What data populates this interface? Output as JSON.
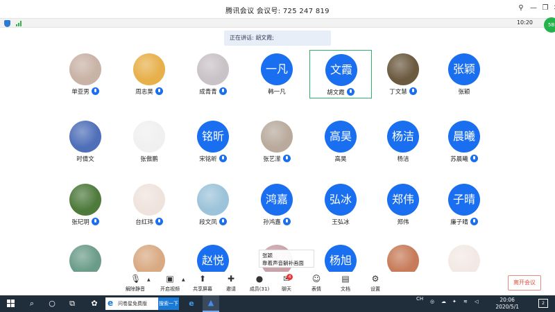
{
  "window": {
    "title": "腾讯会议  会议号: 725 247 819",
    "controls": [
      "⚲",
      "—",
      "❐",
      "✕"
    ]
  },
  "statusbar": {
    "time": "10:20",
    "bubble": "5B"
  },
  "speaking": "正在讲话: 胡文霞;",
  "participants": [
    {
      "name": "单亚男",
      "type": "photo",
      "color": "#c9b2a6",
      "mic": true
    },
    {
      "name": "周志昊",
      "type": "photo",
      "color": "#e7b04a",
      "mic": true
    },
    {
      "name": "成青青",
      "type": "photo",
      "color": "#c9c2c6",
      "mic": true
    },
    {
      "name": "韩一凡",
      "type": "text",
      "initials": "一凡",
      "mic": false
    },
    {
      "name": "胡文霞",
      "type": "text",
      "initials": "文霞",
      "mic": true,
      "active": true
    },
    {
      "name": "丁文慧",
      "type": "photo",
      "color": "#6c5a40",
      "mic": true
    },
    {
      "name": "张颖",
      "type": "text",
      "initials": "张颖",
      "mic": false
    },
    {
      "name": "时倩文",
      "type": "photo",
      "color": "#4f6fb8",
      "mic": false
    },
    {
      "name": "张傲鹏",
      "type": "photo",
      "color": "#f0f0f0",
      "mic": false
    },
    {
      "name": "宋铭昕",
      "type": "text",
      "initials": "铭昕",
      "mic": true
    },
    {
      "name": "张艺潆",
      "type": "photo",
      "color": "#b9aa9c",
      "mic": true
    },
    {
      "name": "高昊",
      "type": "text",
      "initials": "高昊",
      "mic": false
    },
    {
      "name": "杨洁",
      "type": "text",
      "initials": "杨洁",
      "mic": false
    },
    {
      "name": "苏晨曦",
      "type": "text",
      "initials": "晨曦",
      "mic": true
    },
    {
      "name": "张玘玥",
      "type": "photo",
      "color": "#4e7a3c",
      "mic": true
    },
    {
      "name": "台红玮",
      "type": "photo",
      "color": "#efe3dd",
      "mic": true
    },
    {
      "name": "段文凤",
      "type": "photo",
      "color": "#9cc3d9",
      "mic": true
    },
    {
      "name": "孙鸿嘉",
      "type": "text",
      "initials": "鸿嘉",
      "mic": true
    },
    {
      "name": "王弘冰",
      "type": "text",
      "initials": "弘冰",
      "mic": false
    },
    {
      "name": "郑伟",
      "type": "text",
      "initials": "郑伟",
      "mic": false
    },
    {
      "name": "廉子晴",
      "type": "text",
      "initials": "子晴",
      "mic": true
    },
    {
      "name": "",
      "type": "photo",
      "color": "#6b9c8a",
      "mic": false
    },
    {
      "name": "",
      "type": "photo",
      "color": "#d9a982",
      "mic": false
    },
    {
      "name": "",
      "type": "text",
      "initials": "赵悦",
      "mic": false
    },
    {
      "name": "",
      "type": "photo",
      "color": "#c8a0a8",
      "mic": false
    },
    {
      "name": "",
      "type": "text",
      "initials": "杨旭",
      "mic": false
    },
    {
      "name": "",
      "type": "photo",
      "color": "#c77b59",
      "mic": false
    },
    {
      "name": "",
      "type": "photo",
      "color": "#f3e9e4",
      "mic": false
    }
  ],
  "tooltip": {
    "name": "张颖",
    "text": "靠着声音躺补画面"
  },
  "toolbar": {
    "buttons": [
      {
        "label": "解除静音",
        "icon": "mic-off-icon",
        "glyph": "🎙"
      },
      {
        "label": "开启视频",
        "icon": "camera-off-icon",
        "glyph": "▣"
      },
      {
        "label": "共享屏幕",
        "icon": "share-screen-icon",
        "glyph": "⬆"
      },
      {
        "label": "邀请",
        "icon": "invite-icon",
        "glyph": "✚"
      },
      {
        "label": "成员(31)",
        "icon": "members-icon",
        "glyph": "●"
      },
      {
        "label": "聊天",
        "icon": "chat-icon",
        "glyph": "✉"
      },
      {
        "label": "表情",
        "icon": "emoji-icon",
        "glyph": "☺"
      },
      {
        "label": "文档",
        "icon": "document-icon",
        "glyph": "▤"
      },
      {
        "label": "设置",
        "icon": "settings-icon",
        "glyph": "⚙"
      }
    ],
    "chat_badge": "4",
    "leave_label": "离开会议"
  },
  "taskbar": {
    "search_placeholder": "问卷星免费版",
    "search_button": "搜索一下",
    "ime": "CH",
    "time": "20:06",
    "date": "2020/5/1",
    "notifications": "2"
  }
}
